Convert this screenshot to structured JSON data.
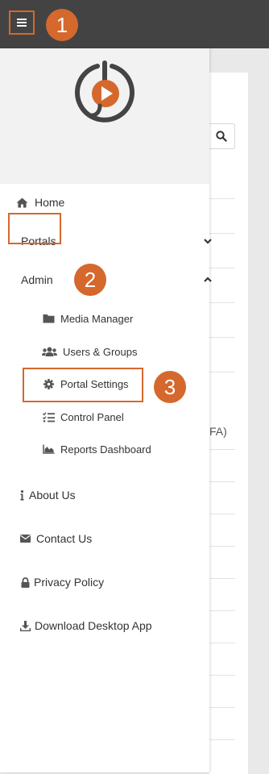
{
  "callouts": [
    "1",
    "2",
    "3"
  ],
  "nav": {
    "home": "Home",
    "portals": "Portals",
    "admin": "Admin",
    "admin_items": {
      "media_manager": "Media Manager",
      "users_groups": "Users & Groups",
      "portal_settings": "Portal Settings",
      "control_panel": "Control Panel",
      "reports_dashboard": "Reports Dashboard"
    },
    "about": "About Us",
    "contact": "Contact Us",
    "privacy": "Privacy Policy",
    "download": "Download Desktop App"
  },
  "background_page": {
    "visible_text_fragment": "FA)"
  },
  "colors": {
    "accent": "#d5682d",
    "topbar": "#434343",
    "logo_gray": "#444444"
  },
  "icons": {
    "menu": "hamburger-icon",
    "home": "home-icon",
    "portals_chevron": "chevron-down-icon",
    "admin_chevron": "chevron-up-icon",
    "media_manager": "folder-icon",
    "users_groups": "users-icon",
    "portal_settings": "gear-icon",
    "control_panel": "list-check-icon",
    "reports_dashboard": "area-chart-icon",
    "about": "info-icon",
    "contact": "envelope-icon",
    "privacy": "lock-icon",
    "download": "download-icon",
    "search": "search-icon"
  }
}
